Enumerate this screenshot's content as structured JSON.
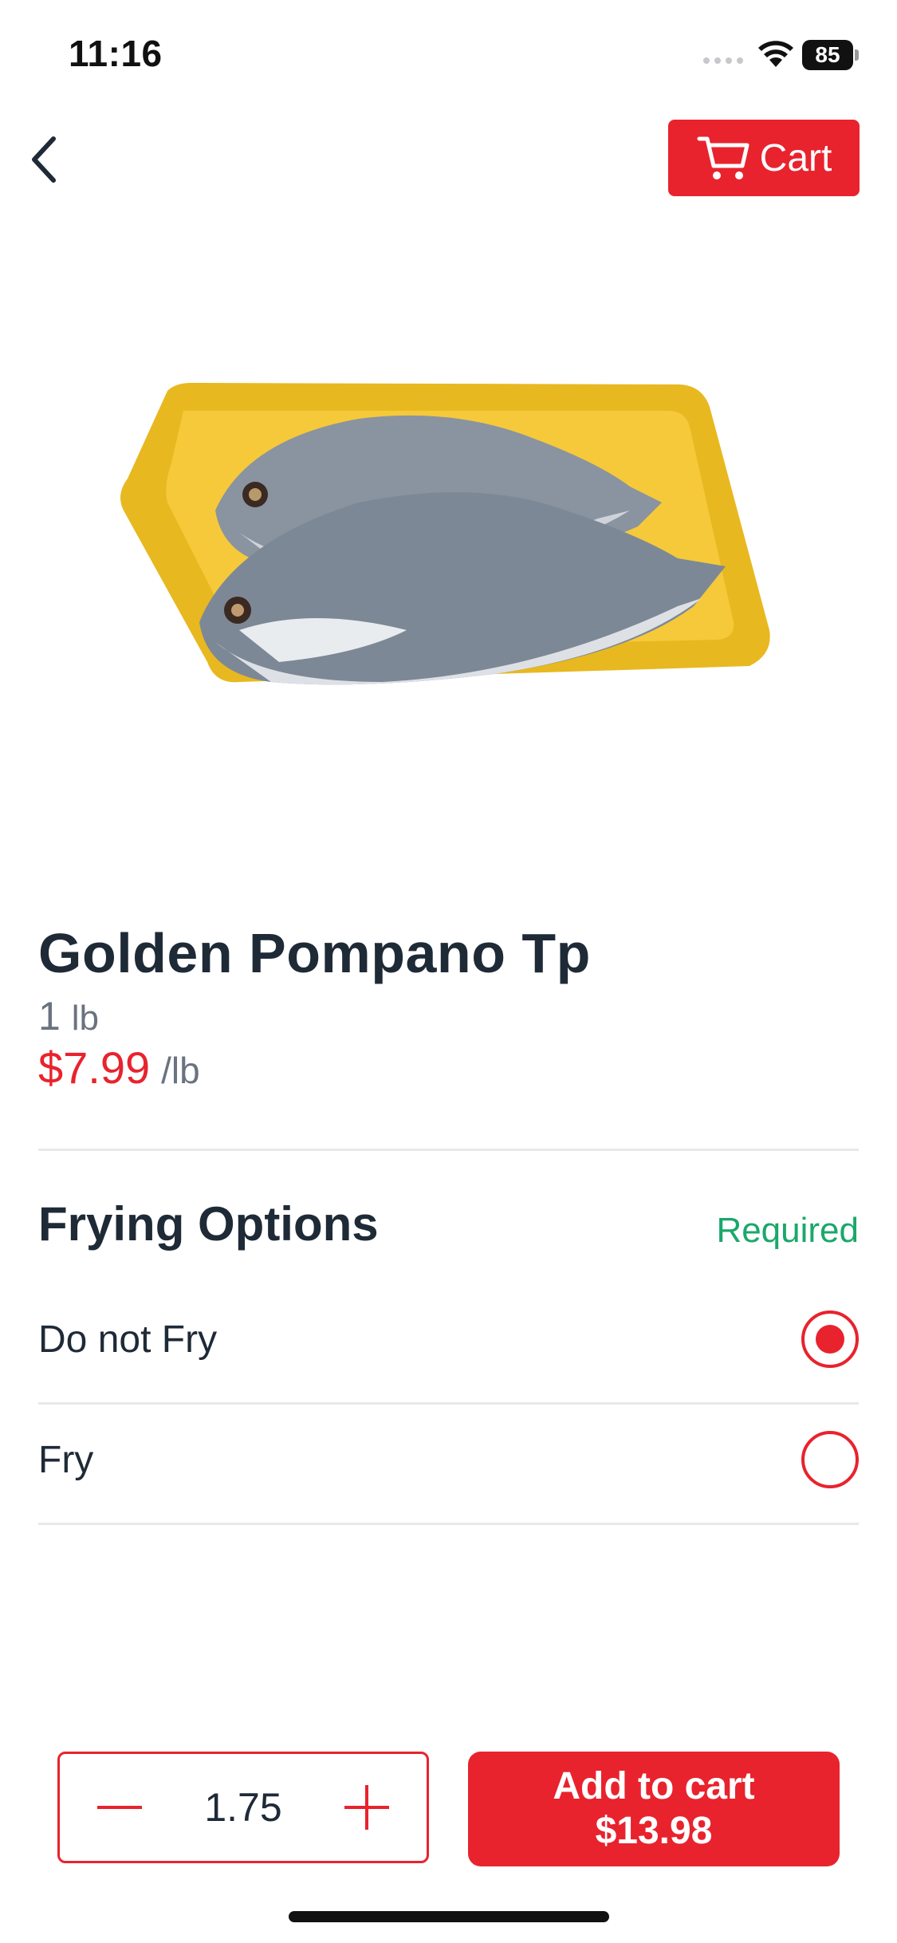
{
  "status_bar": {
    "time": "11:16",
    "battery": "85",
    "icons": [
      "signal-icon",
      "wifi-icon",
      "battery-icon"
    ]
  },
  "nav": {
    "back_icon": "chevron-left-icon",
    "cart_label": "Cart",
    "cart_icon": "cart-icon"
  },
  "product": {
    "title": "Golden Pompano Tp",
    "weight_value": "1",
    "weight_unit": "lb",
    "price": "$7.99",
    "price_unit": "/lb"
  },
  "options": {
    "title": "Frying Options",
    "required_label": "Required",
    "items": [
      {
        "label": "Do not Fry",
        "selected": true
      },
      {
        "label": "Fry",
        "selected": false
      }
    ]
  },
  "footer": {
    "quantity": "1.75",
    "add_label": "Add to cart",
    "total": "$13.98"
  },
  "colors": {
    "accent": "#e8232e",
    "required": "#1aa86a",
    "text": "#1f2a37",
    "muted": "#6b7280"
  }
}
